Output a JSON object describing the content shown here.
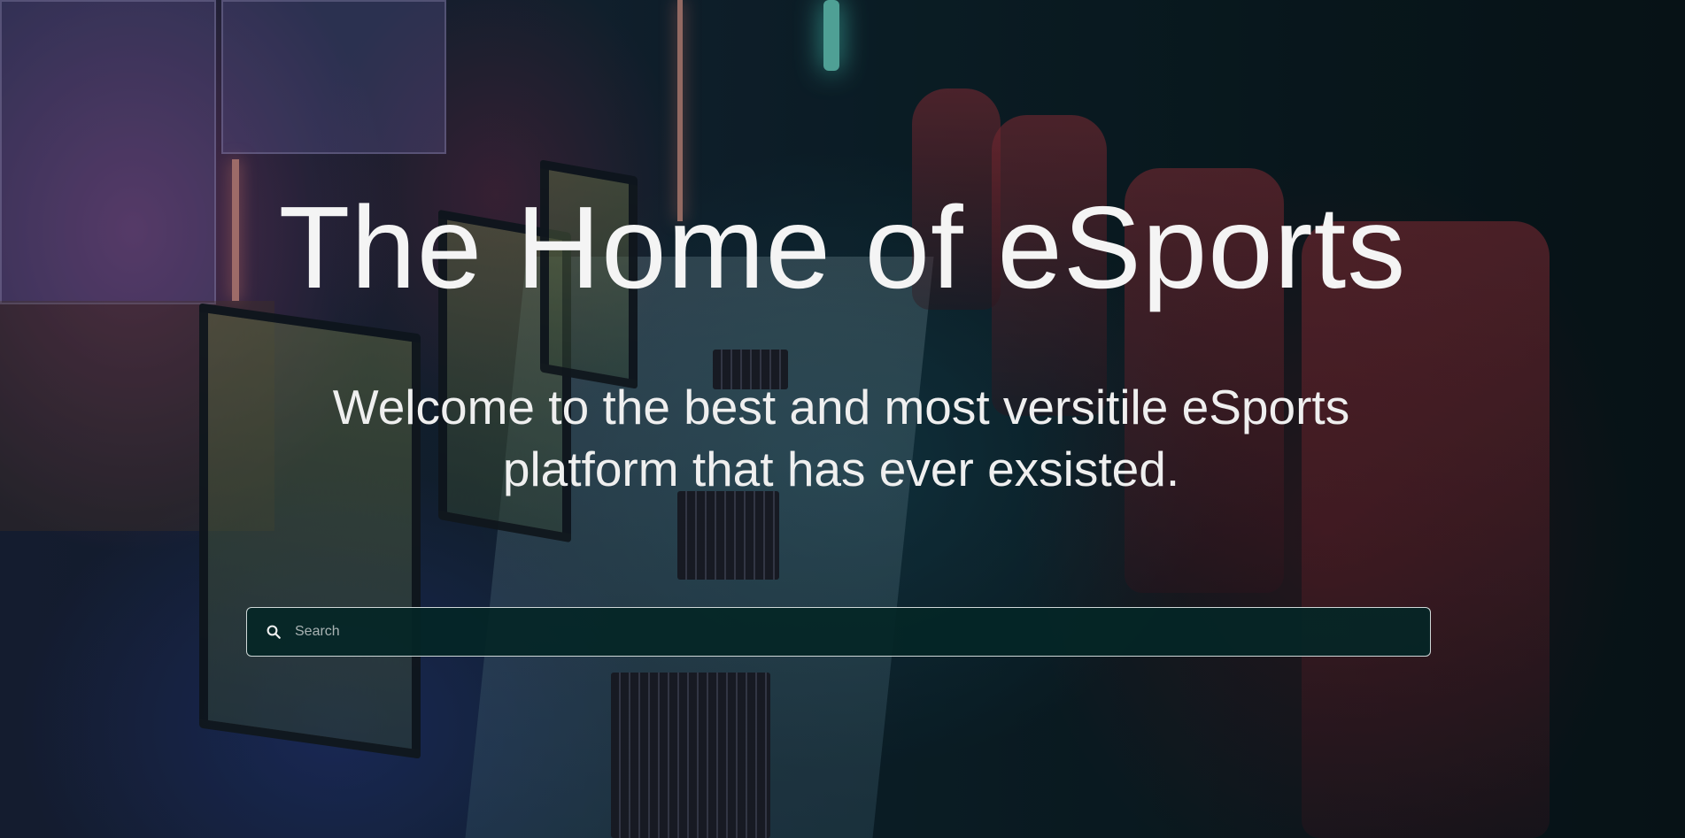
{
  "hero": {
    "title": "The Home of eSports",
    "subtitle": "Welcome to the best and most versitile eSports platform that has ever exsisted."
  },
  "search": {
    "placeholder": "Search",
    "value": "",
    "icon": "search-icon"
  },
  "colors": {
    "text": "#f4f4f4",
    "search_bg": "#042626",
    "search_border": "#cfd8d8"
  }
}
